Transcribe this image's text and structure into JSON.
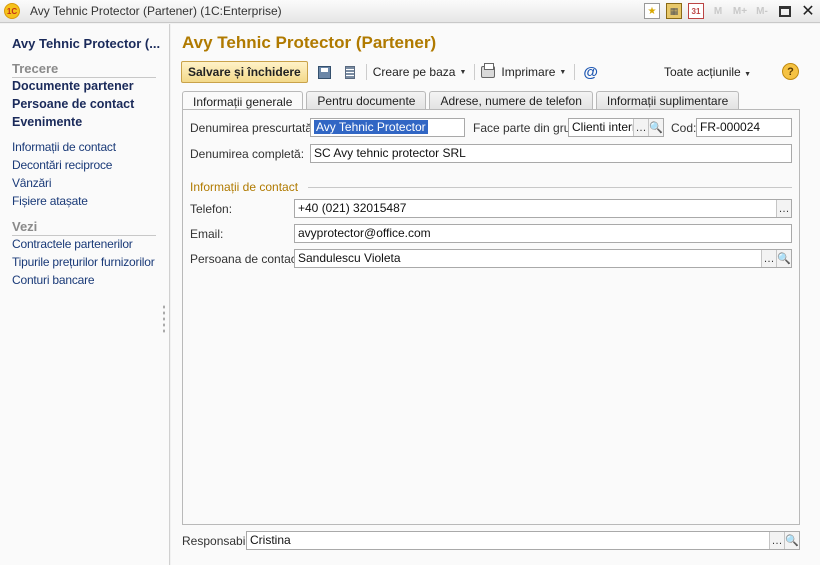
{
  "window": {
    "title": "Avy Tehnic Protector (Partener)  (1C:Enterprise)",
    "logo_text": "1C",
    "toolbar_icons": [
      "favorites-icon",
      "calculator-icon",
      "calendar-icon",
      "m-icon",
      "m-plus-icon",
      "m-minus-icon",
      "maximize-icon",
      "close-icon"
    ],
    "calendar_day": "31",
    "m_labels": [
      "M",
      "M+",
      "M-"
    ]
  },
  "sidebar": {
    "title": "Avy Tehnic Protector (...",
    "section_trecere": "Trecere",
    "bold_items": [
      "Documente partener",
      "Persoane de contact",
      "Evenimente"
    ],
    "links": [
      "Informații de contact",
      "Decontări reciproce",
      "Vânzări",
      "Fișiere atașate"
    ],
    "section_vezi": "Vezi",
    "vezi_links": [
      "Contractele partenerilor",
      "Tipurile prețurilor furnizorilor",
      "Conturi bancare"
    ]
  },
  "form": {
    "title": "Avy Tehnic Protector (Partener)",
    "toolbar": {
      "save_close": "Salvare și închidere",
      "create_based": "Creare pe baza",
      "print": "Imprimare",
      "all_actions": "Toate acțiunile",
      "help": "?"
    },
    "tabs": [
      "Informații generale",
      "Pentru documente",
      "Adrese, numere de telefon",
      "Informații suplimentare"
    ],
    "fields": {
      "short_name_label": "Denumirea prescurtată :",
      "short_name_value": "Avy Tehnic Protector",
      "group_label": "Face parte din grup:",
      "group_value": "Clienti interni",
      "code_label": "Cod:",
      "code_value": "FR-000024",
      "full_name_label": "Denumirea completă:",
      "full_name_value": "SC Avy tehnic protector SRL",
      "contact_section": "Informații de contact",
      "phone_label": "Telefon:",
      "phone_value": "+40 (021) 32015487",
      "email_label": "Email:",
      "email_value": "avyprotector@office.com",
      "contact_person_label": "Persoana de contact:",
      "contact_person_value": "Sandulescu Violeta"
    },
    "responsible_label": "Responsabil:",
    "responsible_value": "Cristina"
  },
  "colors": {
    "title_accent": "#b07a00",
    "nav_text": "#1a2a5a",
    "selection": "#3166c4",
    "primary_button": "#f3d98a"
  }
}
